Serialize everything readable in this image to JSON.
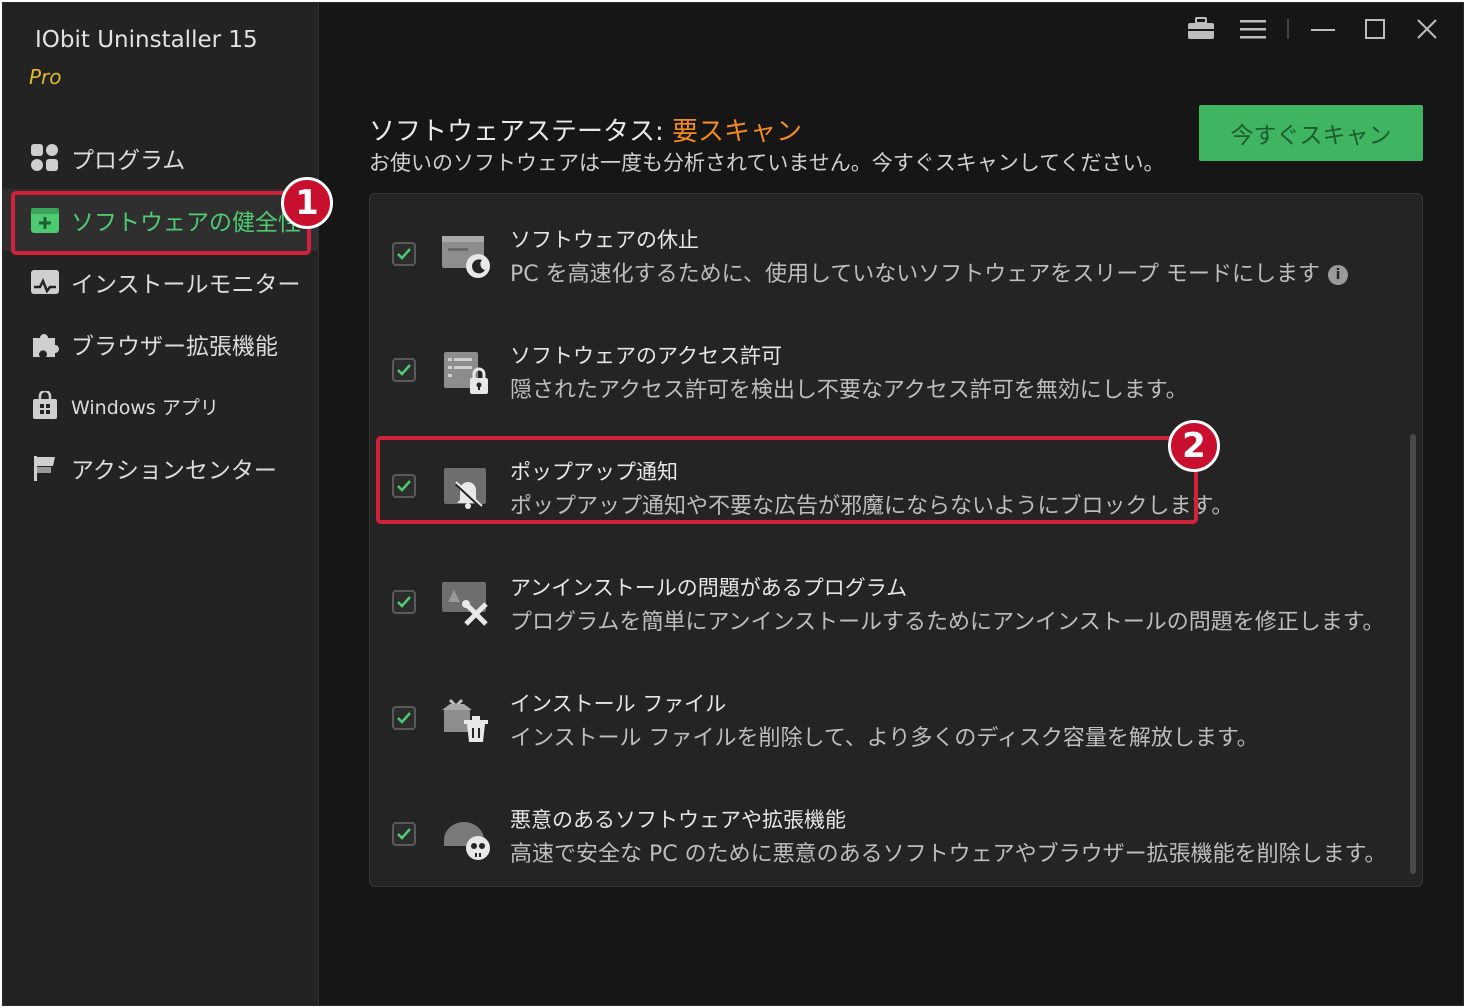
{
  "app": {
    "title": "IObit Uninstaller 15",
    "edition": "Pro"
  },
  "sidebar": {
    "items": [
      {
        "label": "プログラム",
        "icon": "apps-grid-icon"
      },
      {
        "label": "ソフトウェアの健全性",
        "icon": "software-health-icon",
        "active": true
      },
      {
        "label": "インストールモニター",
        "icon": "install-monitor-icon"
      },
      {
        "label": "ブラウザー拡張機能",
        "icon": "puzzle-icon"
      },
      {
        "label": "Windows アプリ",
        "icon": "windows-store-icon"
      },
      {
        "label": "アクションセンター",
        "icon": "flag-icon"
      }
    ]
  },
  "window_controls": [
    "toolbox-icon",
    "menu-icon",
    "minimize-icon",
    "maximize-icon",
    "close-icon"
  ],
  "main": {
    "status_prefix": "ソフトウェアステータス: ",
    "status_value": "要スキャン",
    "status_description": "お使いのソフトウェアは一度も分析されていません。今すぐスキャンしてください。",
    "scan_button": "今すぐスキャン"
  },
  "items": [
    {
      "title": "ソフトウェアの休止",
      "description": "PC を高速化するために、使用していないソフトウェアをスリープ モードにします",
      "icon": "sleep-app-icon",
      "checked": true,
      "info": "i"
    },
    {
      "title": "ソフトウェアのアクセス許可",
      "description": "隠されたアクセス許可を検出し不要なアクセス許可を無効にします。",
      "icon": "permission-lock-icon",
      "checked": true
    },
    {
      "title": "ポップアップ通知",
      "description": "ポップアップ通知や不要な広告が邪魔にならないようにブロックします。",
      "icon": "bell-off-icon",
      "checked": true
    },
    {
      "title": "アンインストールの問題があるプログラム",
      "description": "プログラムを簡単にアンインストールするためにアンインストールの問題を修正します。",
      "icon": "repair-tools-icon",
      "checked": true
    },
    {
      "title": "インストール ファイル",
      "description": "インストール ファイルを削除して、より多くのディスク容量を解放します。",
      "icon": "installer-trash-icon",
      "checked": true
    },
    {
      "title": "悪意のあるソフトウェアや拡張機能",
      "description": "高速で安全な PC のために悪意のあるソフトウェアやブラウザー拡張機能を削除します。",
      "icon": "malware-skull-icon",
      "checked": true
    }
  ],
  "annotations": {
    "badge1": "1",
    "badge2": "2"
  },
  "colors": {
    "accent_green": "#4ecb71",
    "status_orange": "#f28a1f",
    "highlight_red": "#d2213a"
  }
}
